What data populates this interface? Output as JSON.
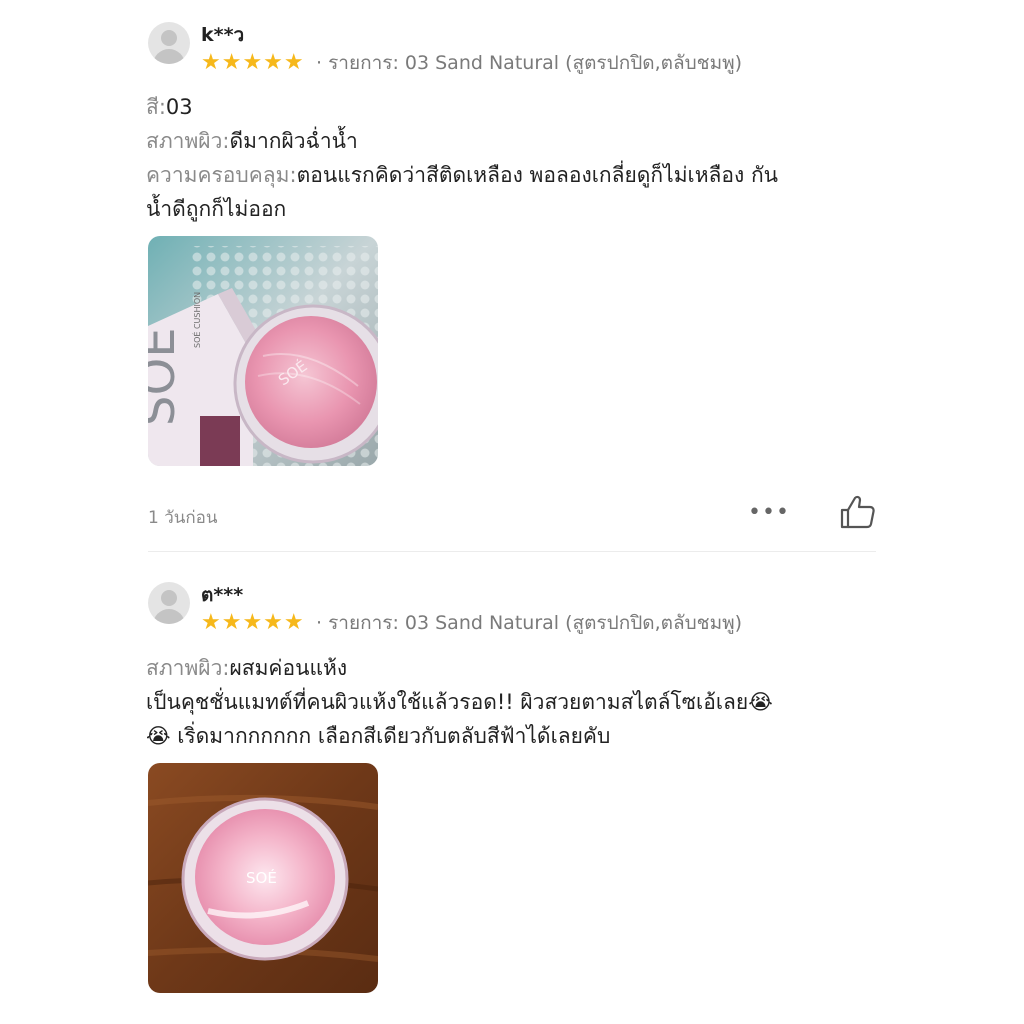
{
  "reviews": [
    {
      "username": "k**ว",
      "stars": "★★★★★",
      "variant": "· รายการ: 03 Sand Natural (สูตรปกปิด,ตลับชมพู)",
      "fields": [
        {
          "label": "สี:",
          "value": "03"
        },
        {
          "label": "สภาพผิว:",
          "value": "ดีมากผิวฉ่ำน้ำ"
        },
        {
          "label": "ความครอบคลุม:",
          "value": "ตอนแรกคิดว่าสีติดเหลือง พอลองเกลี่ยดูก็ไม่เหลือง กัน"
        }
      ],
      "continuation": "น้ำดีถูกก็ไม่ออก",
      "photo_brand": "SOÉ",
      "box_text": "SOÉ",
      "box_small_text": "SOÉ CUSHION",
      "timestamp": "1 วันก่อน",
      "more_label": "•••"
    },
    {
      "username": "ต***",
      "stars": "★★★★★",
      "variant": "· รายการ: 03 Sand Natural (สูตรปกปิด,ตลับชมพู)",
      "fields": [
        {
          "label": "สภาพผิว:",
          "value": "ผสมค่อนแห้ง"
        }
      ],
      "body_line1": "เป็นคุชชั่นแมทต์ที่คนผิวแห้งใช้แล้วรอด!! ผิวสวยตามสไตล์โซเอ้เลย😭",
      "body_line2": "😭 เริ่ดมากกกกกก เลือกสีเดียวกับตลับสีฟ้าได้เลยคับ",
      "photo_brand": "SOÉ"
    }
  ],
  "colors": {
    "star": "#f6b81b",
    "label_gray": "#8a8a8a",
    "divider": "#ececec"
  }
}
